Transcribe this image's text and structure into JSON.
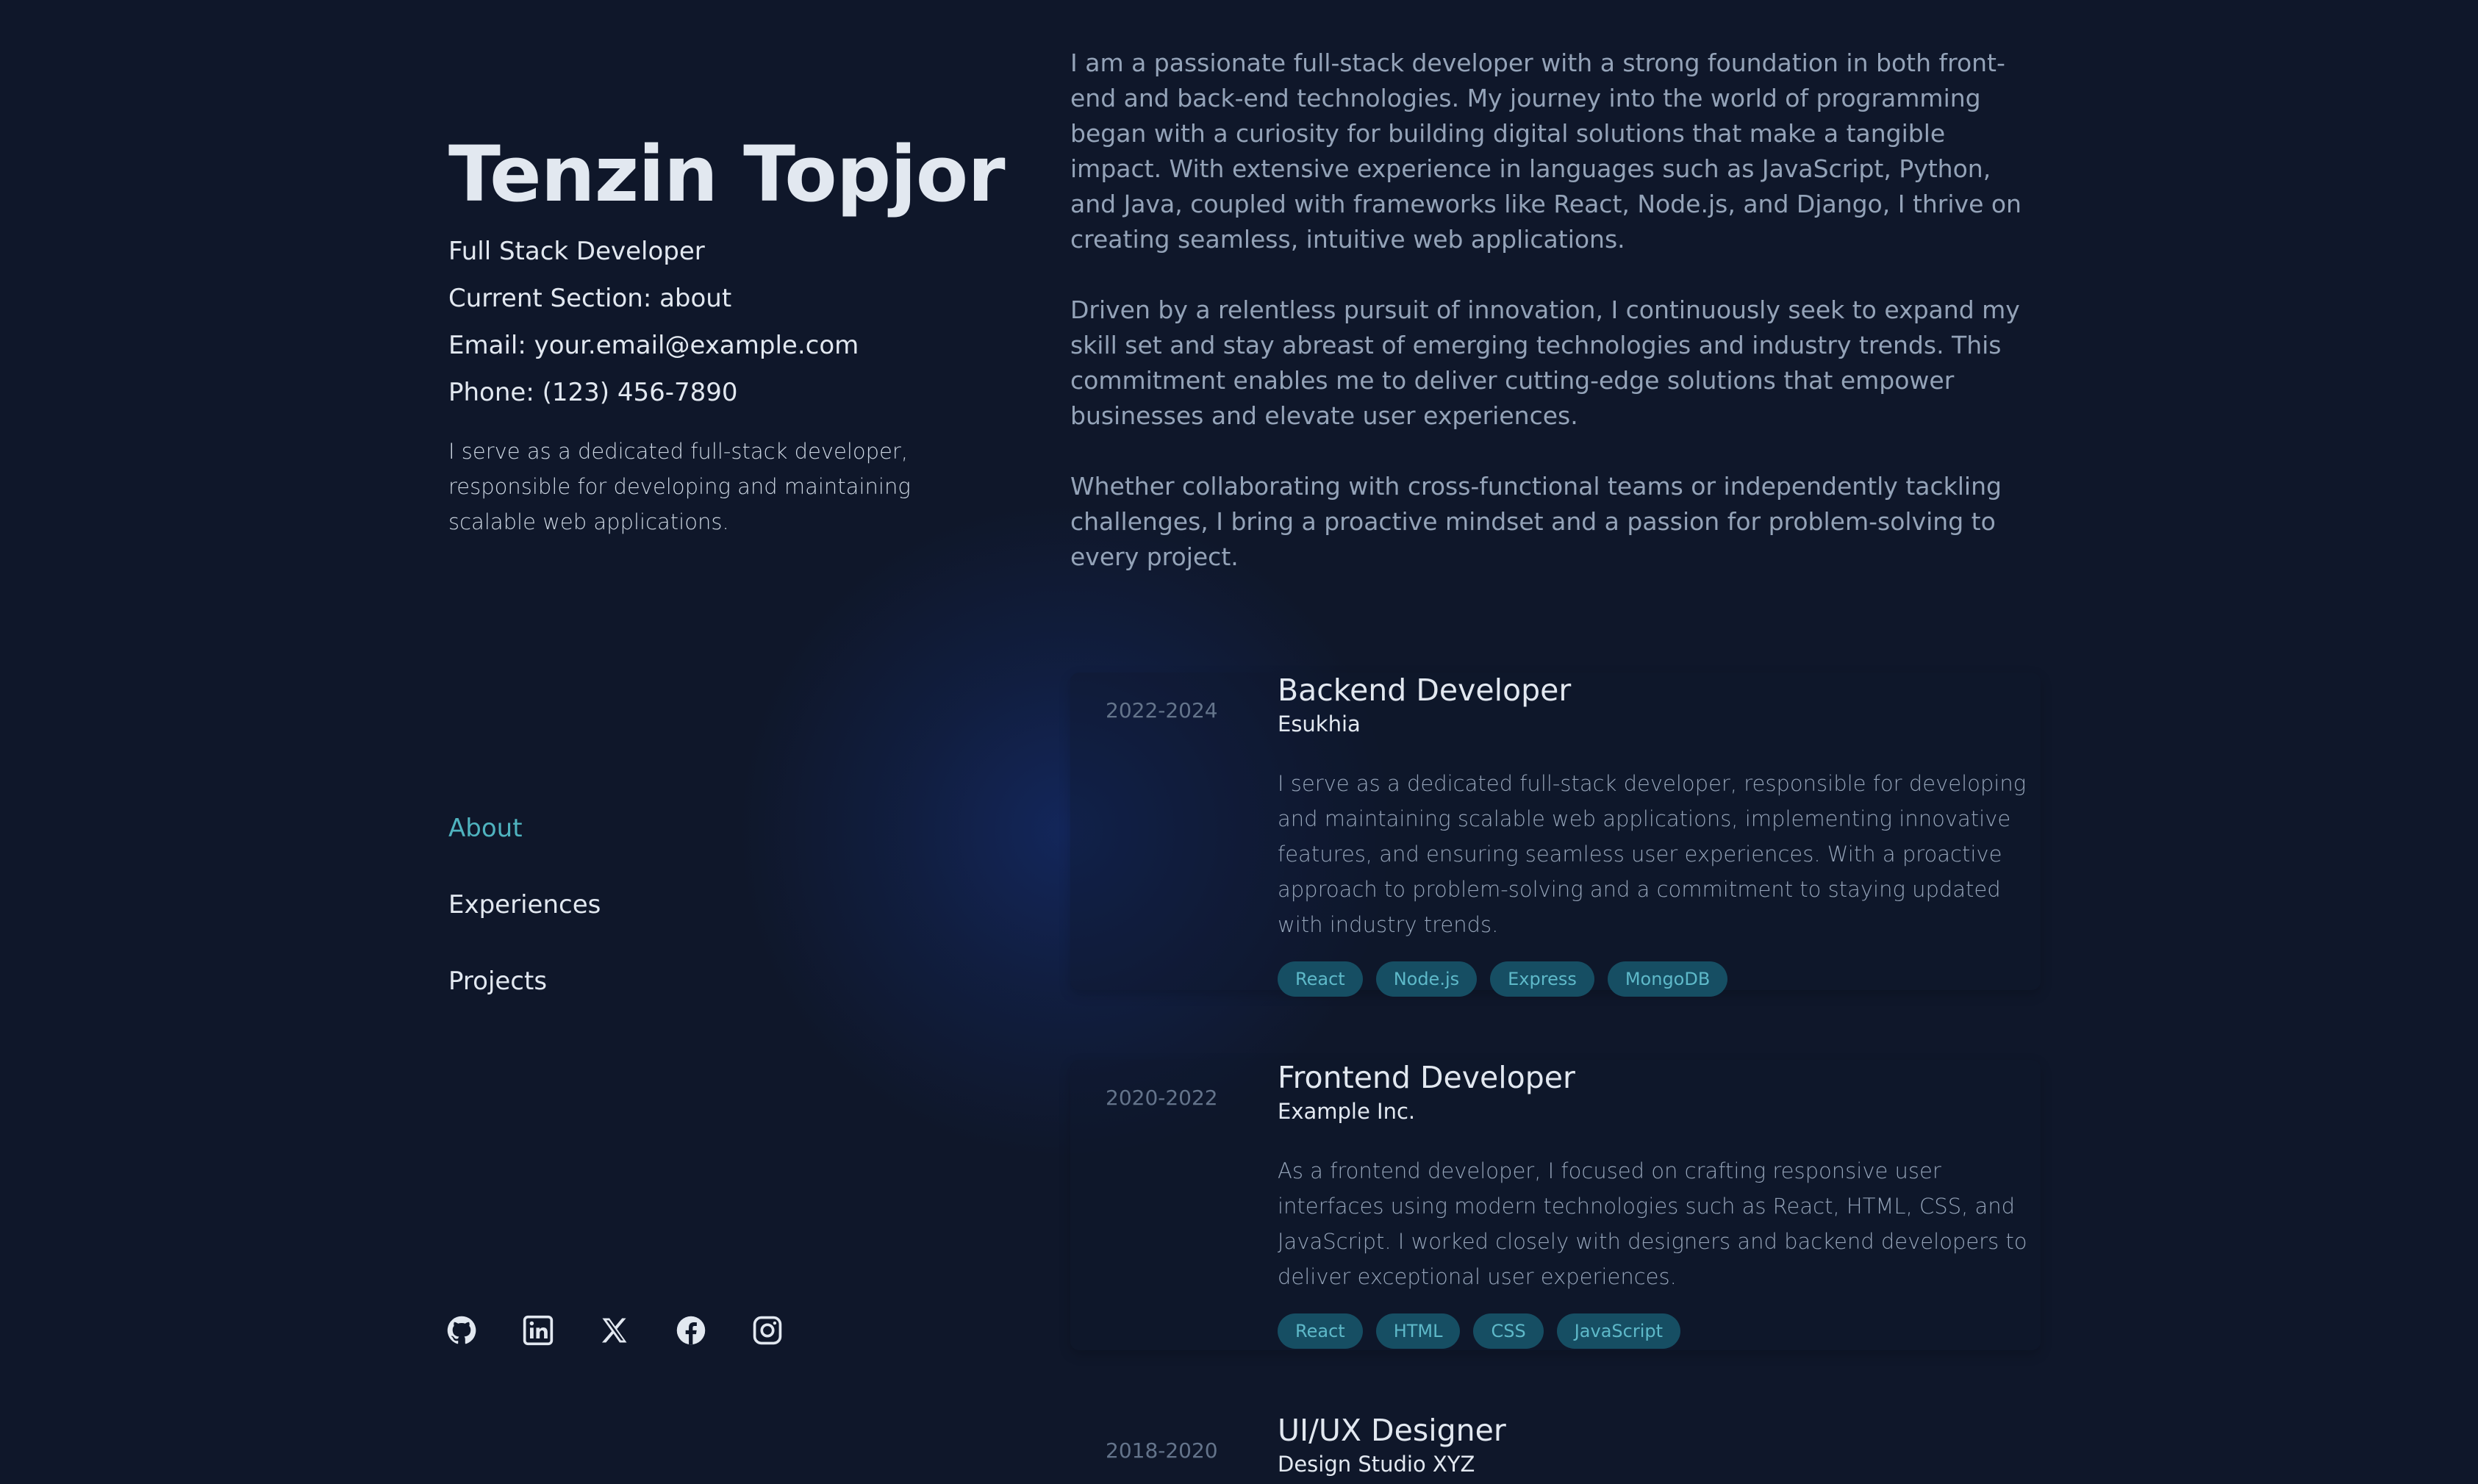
{
  "profile": {
    "name": "Tenzin Topjor",
    "role": "Full Stack Developer",
    "current_section": "Current Section: about",
    "email": "Email: your.email@example.com",
    "phone": "Phone: (123) 456-7890",
    "summary": "I serve as a dedicated full-stack developer, responsible for developing and maintaining scalable web applications."
  },
  "nav": {
    "items": [
      {
        "label": "About",
        "active": true
      },
      {
        "label": "Experiences",
        "active": false
      },
      {
        "label": "Projects",
        "active": false
      }
    ]
  },
  "socials": [
    "github-icon",
    "linkedin-icon",
    "x-icon",
    "facebook-icon",
    "instagram-icon"
  ],
  "bio": {
    "paragraphs": [
      "I am a passionate full-stack developer with a strong foundation in both front-end and back-end technologies. My journey into the world of programming began with a curiosity for building digital solutions that make a tangible impact. With extensive experience in languages such as JavaScript, Python, and Java, coupled with frameworks like React, Node.js, and Django, I thrive on creating seamless, intuitive web applications.",
      "Driven by a relentless pursuit of innovation, I continuously seek to expand my skill set and stay abreast of emerging technologies and industry trends. This commitment enables me to deliver cutting-edge solutions that empower businesses and elevate user experiences.",
      "Whether collaborating with cross-functional teams or independently tackling challenges, I bring a proactive mindset and a passion for problem-solving to every project."
    ]
  },
  "experiences": [
    {
      "date": "2022-2024",
      "title": "Backend Developer",
      "company": "Esukhia",
      "description": "I serve as a dedicated full-stack developer, responsible for developing and maintaining scalable web applications, implementing innovative features, and ensuring seamless user experiences. With a proactive approach to problem-solving and a commitment to staying updated with industry trends.",
      "tags": [
        "React",
        "Node.js",
        "Express",
        "MongoDB"
      ]
    },
    {
      "date": "2020-2022",
      "title": "Frontend Developer",
      "company": "Example Inc.",
      "description": "As a frontend developer, I focused on crafting responsive user interfaces using modern technologies such as React, HTML, CSS, and JavaScript. I worked closely with designers and backend developers to deliver exceptional user experiences.",
      "tags": [
        "React",
        "HTML",
        "CSS",
        "JavaScript"
      ]
    },
    {
      "date": "2018-2020",
      "title": "UI/UX Designer",
      "company": "Design Studio XYZ"
    }
  ],
  "colors": {
    "background": "#0f172a",
    "accent": "#4fb3bf",
    "tag_bg": "#164e63",
    "tag_text": "#5eb9c9"
  }
}
